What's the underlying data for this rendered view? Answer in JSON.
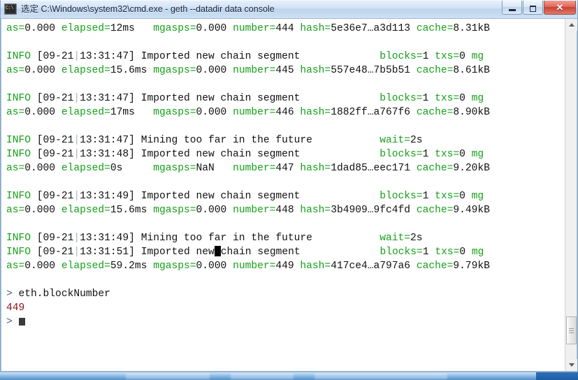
{
  "window": {
    "title": "选定 C:\\Windows\\system32\\cmd.exe - geth  --datadir data console",
    "icon": "cmd-icon",
    "minimize_label": "Minimize",
    "maximize_label": "Restore",
    "close_label": "Close"
  },
  "scrollbar": {
    "up_arrow": "▲",
    "down_arrow": "▼"
  },
  "console": {
    "lines": [
      {
        "type": "kv",
        "segments": [
          {
            "t": "as=",
            "c": "k"
          },
          {
            "t": "0.000 ",
            "c": "v"
          },
          {
            "t": "elapsed=",
            "c": "k"
          },
          {
            "t": "12ms   ",
            "c": "v"
          },
          {
            "t": "mgasps=",
            "c": "k"
          },
          {
            "t": "0.000 ",
            "c": "v"
          },
          {
            "t": "number=",
            "c": "k"
          },
          {
            "t": "444 ",
            "c": "v"
          },
          {
            "t": "hash=",
            "c": "k"
          },
          {
            "t": "5e36e7…a3d113 ",
            "c": "v"
          },
          {
            "t": "cache=",
            "c": "k"
          },
          {
            "t": "8.31kB",
            "c": "v"
          }
        ]
      },
      {
        "type": "blank",
        "segments": []
      },
      {
        "type": "log",
        "segments": [
          {
            "t": "INFO ",
            "c": "k"
          },
          {
            "t": "[09-21",
            "c": "v"
          },
          {
            "t": "|",
            "c": "sep"
          },
          {
            "t": "13:31:47] ",
            "c": "v"
          },
          {
            "t": "Imported new chain segment",
            "c": "v"
          },
          {
            "t": "             ",
            "c": "v"
          },
          {
            "t": "blocks=",
            "c": "k"
          },
          {
            "t": "1 ",
            "c": "v"
          },
          {
            "t": "txs=",
            "c": "k"
          },
          {
            "t": "0 ",
            "c": "v"
          },
          {
            "t": "mg",
            "c": "k"
          }
        ]
      },
      {
        "type": "kv",
        "segments": [
          {
            "t": "as=",
            "c": "k"
          },
          {
            "t": "0.000 ",
            "c": "v"
          },
          {
            "t": "elapsed=",
            "c": "k"
          },
          {
            "t": "15.6ms ",
            "c": "v"
          },
          {
            "t": "mgasps=",
            "c": "k"
          },
          {
            "t": "0.000 ",
            "c": "v"
          },
          {
            "t": "number=",
            "c": "k"
          },
          {
            "t": "445 ",
            "c": "v"
          },
          {
            "t": "hash=",
            "c": "k"
          },
          {
            "t": "557e48…7b5b51 ",
            "c": "v"
          },
          {
            "t": "cache=",
            "c": "k"
          },
          {
            "t": "8.61kB",
            "c": "v"
          }
        ]
      },
      {
        "type": "blank",
        "segments": []
      },
      {
        "type": "log",
        "segments": [
          {
            "t": "INFO ",
            "c": "k"
          },
          {
            "t": "[09-21",
            "c": "v"
          },
          {
            "t": "|",
            "c": "sep"
          },
          {
            "t": "13:31:47] ",
            "c": "v"
          },
          {
            "t": "Imported new chain segment",
            "c": "v"
          },
          {
            "t": "             ",
            "c": "v"
          },
          {
            "t": "blocks=",
            "c": "k"
          },
          {
            "t": "1 ",
            "c": "v"
          },
          {
            "t": "txs=",
            "c": "k"
          },
          {
            "t": "0 ",
            "c": "v"
          },
          {
            "t": "mg",
            "c": "k"
          }
        ]
      },
      {
        "type": "kv",
        "segments": [
          {
            "t": "as=",
            "c": "k"
          },
          {
            "t": "0.000 ",
            "c": "v"
          },
          {
            "t": "elapsed=",
            "c": "k"
          },
          {
            "t": "17ms   ",
            "c": "v"
          },
          {
            "t": "mgasps=",
            "c": "k"
          },
          {
            "t": "0.000 ",
            "c": "v"
          },
          {
            "t": "number=",
            "c": "k"
          },
          {
            "t": "446 ",
            "c": "v"
          },
          {
            "t": "hash=",
            "c": "k"
          },
          {
            "t": "1882ff…a767f6 ",
            "c": "v"
          },
          {
            "t": "cache=",
            "c": "k"
          },
          {
            "t": "8.90kB",
            "c": "v"
          }
        ]
      },
      {
        "type": "blank",
        "segments": []
      },
      {
        "type": "log",
        "segments": [
          {
            "t": "INFO ",
            "c": "k"
          },
          {
            "t": "[09-21",
            "c": "v"
          },
          {
            "t": "|",
            "c": "sep"
          },
          {
            "t": "13:31:47] ",
            "c": "v"
          },
          {
            "t": "Mining too far in the future",
            "c": "v"
          },
          {
            "t": "           ",
            "c": "v"
          },
          {
            "t": "wait=",
            "c": "k"
          },
          {
            "t": "2s",
            "c": "v"
          }
        ]
      },
      {
        "type": "log",
        "segments": [
          {
            "t": "INFO ",
            "c": "k"
          },
          {
            "t": "[09-21",
            "c": "v"
          },
          {
            "t": "|",
            "c": "sep"
          },
          {
            "t": "13:31:48] ",
            "c": "v"
          },
          {
            "t": "Imported new chain segment",
            "c": "v"
          },
          {
            "t": "             ",
            "c": "v"
          },
          {
            "t": "blocks=",
            "c": "k"
          },
          {
            "t": "1 ",
            "c": "v"
          },
          {
            "t": "txs=",
            "c": "k"
          },
          {
            "t": "0 ",
            "c": "v"
          },
          {
            "t": "mg",
            "c": "k"
          }
        ]
      },
      {
        "type": "kv",
        "segments": [
          {
            "t": "as=",
            "c": "k"
          },
          {
            "t": "0.000 ",
            "c": "v"
          },
          {
            "t": "elapsed=",
            "c": "k"
          },
          {
            "t": "0s     ",
            "c": "v"
          },
          {
            "t": "mgasps=",
            "c": "k"
          },
          {
            "t": "NaN   ",
            "c": "v"
          },
          {
            "t": "number=",
            "c": "k"
          },
          {
            "t": "447 ",
            "c": "v"
          },
          {
            "t": "hash=",
            "c": "k"
          },
          {
            "t": "1dad85…eec171 ",
            "c": "v"
          },
          {
            "t": "cache=",
            "c": "k"
          },
          {
            "t": "9.20kB",
            "c": "v"
          }
        ]
      },
      {
        "type": "blank",
        "segments": []
      },
      {
        "type": "log",
        "segments": [
          {
            "t": "INFO ",
            "c": "k"
          },
          {
            "t": "[09-21",
            "c": "v"
          },
          {
            "t": "|",
            "c": "sep"
          },
          {
            "t": "13:31:49] ",
            "c": "v"
          },
          {
            "t": "Imported new chain segment",
            "c": "v"
          },
          {
            "t": "             ",
            "c": "v"
          },
          {
            "t": "blocks=",
            "c": "k"
          },
          {
            "t": "1 ",
            "c": "v"
          },
          {
            "t": "txs=",
            "c": "k"
          },
          {
            "t": "0 ",
            "c": "v"
          },
          {
            "t": "mg",
            "c": "k"
          }
        ]
      },
      {
        "type": "kv",
        "segments": [
          {
            "t": "as=",
            "c": "k"
          },
          {
            "t": "0.000 ",
            "c": "v"
          },
          {
            "t": "elapsed=",
            "c": "k"
          },
          {
            "t": "15.6ms ",
            "c": "v"
          },
          {
            "t": "mgasps=",
            "c": "k"
          },
          {
            "t": "0.000 ",
            "c": "v"
          },
          {
            "t": "number=",
            "c": "k"
          },
          {
            "t": "448 ",
            "c": "v"
          },
          {
            "t": "hash=",
            "c": "k"
          },
          {
            "t": "3b4909…9fc4fd ",
            "c": "v"
          },
          {
            "t": "cache=",
            "c": "k"
          },
          {
            "t": "9.49kB",
            "c": "v"
          }
        ]
      },
      {
        "type": "blank",
        "segments": []
      },
      {
        "type": "log",
        "segments": [
          {
            "t": "INFO ",
            "c": "k"
          },
          {
            "t": "[09-21",
            "c": "v"
          },
          {
            "t": "|",
            "c": "sep"
          },
          {
            "t": "13:31:49] ",
            "c": "v"
          },
          {
            "t": "Mining too far in the future",
            "c": "v"
          },
          {
            "t": "           ",
            "c": "v"
          },
          {
            "t": "wait=",
            "c": "k"
          },
          {
            "t": "2s",
            "c": "v"
          }
        ]
      },
      {
        "type": "log",
        "has_selection_block": true,
        "segments": [
          {
            "t": "INFO ",
            "c": "k"
          },
          {
            "t": "[09-21",
            "c": "v"
          },
          {
            "t": "|",
            "c": "sep"
          },
          {
            "t": "13:31:51] ",
            "c": "v"
          },
          {
            "t": "Imported new",
            "c": "v"
          },
          {
            "t": "__BLOCK__",
            "c": "blk"
          },
          {
            "t": "chain segment",
            "c": "v"
          },
          {
            "t": "             ",
            "c": "v"
          },
          {
            "t": "blocks=",
            "c": "k"
          },
          {
            "t": "1 ",
            "c": "v"
          },
          {
            "t": "txs=",
            "c": "k"
          },
          {
            "t": "0 ",
            "c": "v"
          },
          {
            "t": "mg",
            "c": "k"
          }
        ]
      },
      {
        "type": "kv",
        "segments": [
          {
            "t": "as=",
            "c": "k"
          },
          {
            "t": "0.000 ",
            "c": "v"
          },
          {
            "t": "elapsed=",
            "c": "k"
          },
          {
            "t": "59.2ms ",
            "c": "v"
          },
          {
            "t": "mgasps=",
            "c": "k"
          },
          {
            "t": "0.000 ",
            "c": "v"
          },
          {
            "t": "number=",
            "c": "k"
          },
          {
            "t": "449 ",
            "c": "v"
          },
          {
            "t": "hash=",
            "c": "k"
          },
          {
            "t": "417ce4…a797a6 ",
            "c": "v"
          },
          {
            "t": "cache=",
            "c": "k"
          },
          {
            "t": "9.79kB",
            "c": "v"
          }
        ]
      },
      {
        "type": "blank",
        "segments": []
      },
      {
        "type": "input",
        "segments": [
          {
            "t": "> ",
            "c": "prompt"
          },
          {
            "t": "eth.blockNumber",
            "c": "v"
          }
        ]
      },
      {
        "type": "output",
        "segments": [
          {
            "t": "449",
            "c": "red"
          }
        ]
      },
      {
        "type": "input",
        "has_cursor": true,
        "segments": [
          {
            "t": ">",
            "c": "prompt"
          }
        ]
      }
    ]
  }
}
